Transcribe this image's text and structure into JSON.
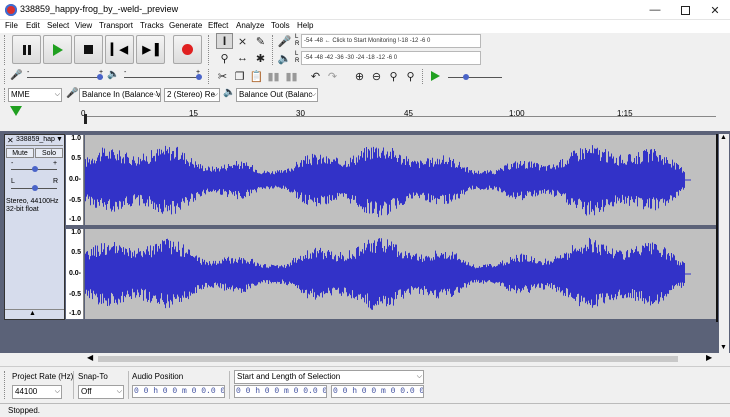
{
  "window": {
    "title": "338859_happy-frog_by_-weld-_preview",
    "minimize_icon": "minimize-icon",
    "maximize_icon": "maximize-icon",
    "close_icon": "close-icon"
  },
  "menu": [
    "File",
    "Edit",
    "Select",
    "View",
    "Transport",
    "Tracks",
    "Generate",
    "Effect",
    "Analyze",
    "Tools",
    "Help"
  ],
  "transport": {
    "pause": "pause-icon",
    "play": "play-icon",
    "stop": "stop-icon",
    "skip_start": "skip-start-icon",
    "skip_end": "skip-end-icon",
    "record": "record-icon"
  },
  "meters": {
    "record_scale": "-54  -48  ← Click to Start Monitoring  !-18  -12   -6    0",
    "playback_scale": "-54  -48  -42  -36  -30  -24  -18  -12   -6    0",
    "rec_L": "L",
    "rec_R": "R",
    "play_L": "L",
    "play_R": "R"
  },
  "device": {
    "host": "MME",
    "input": "Balance In (Balance V",
    "channels": "2 (Stereo) Re",
    "output": "Balance Out (Balanc"
  },
  "ruler": {
    "ticks": [
      "0",
      "15",
      "30",
      "45",
      "1:00",
      "1:15"
    ]
  },
  "track": {
    "name": "338859_hap",
    "mute": "Mute",
    "solo": "Solo",
    "gain_minus": "-",
    "gain_plus": "+",
    "pan_L": "L",
    "pan_R": "R",
    "info1": "Stereo, 44100Hz",
    "info2": "32-bit float",
    "scale": [
      "1.0",
      "0.5",
      "0.0-",
      "-0.5",
      "-1.0"
    ]
  },
  "selection_toolbar": {
    "project_rate_label": "Project Rate (Hz)",
    "project_rate": "44100",
    "snap_label": "Snap-To",
    "snap": "Off",
    "audio_pos_label": "Audio Position",
    "audio_pos": "0 0 h 0 0 m 0 0.0 0 0 s",
    "sel_label": "Start and Length of Selection",
    "sel_start": "0 0 h 0 0 m 0 0.0 0 0 s",
    "sel_end": "0 0 h 0 0 m 0 0.0 0 0 s"
  },
  "status": "Stopped.",
  "colors": {
    "waveform": "#3232c8",
    "track_bg": "#c0c0c0",
    "area_bg": "#5b6278"
  }
}
